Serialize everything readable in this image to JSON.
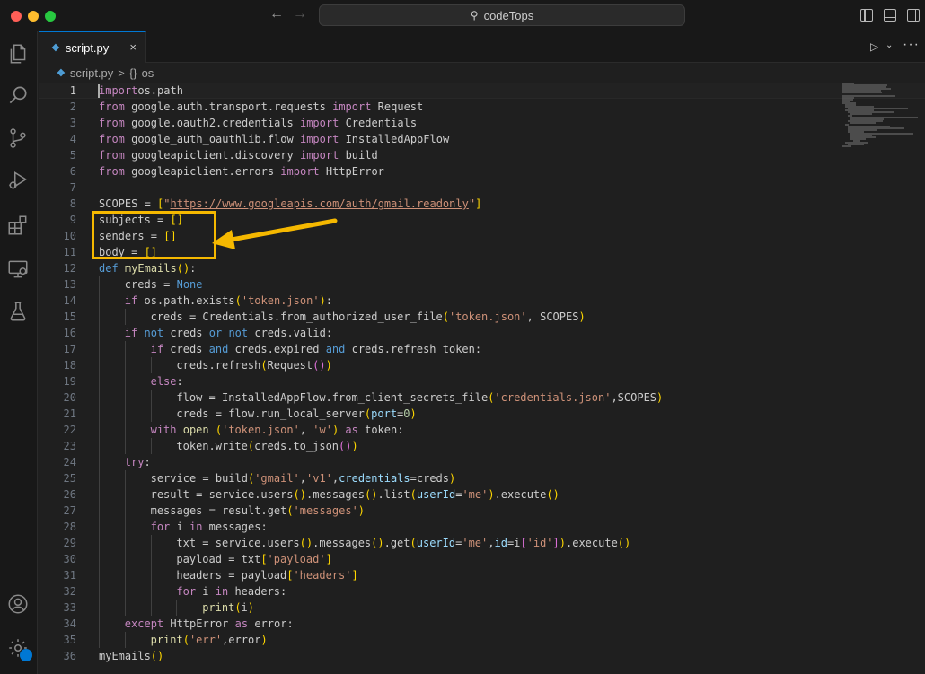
{
  "window": {
    "command_center_text": "codeTops"
  },
  "tab": {
    "label": "script.py",
    "close_glyph": "×"
  },
  "breadcrumb": {
    "file": "script.py",
    "separator": ">",
    "symbol_glyph": "{}",
    "symbol": "os"
  },
  "icons": {
    "activity_bar": [
      "explorer-icon",
      "search-icon",
      "source-control-icon",
      "run-debug-icon",
      "extensions-icon",
      "remote-explorer-icon",
      "testing-icon",
      "account-icon",
      "manage-gear-icon"
    ],
    "title_bar": [
      "back-arrow-icon",
      "forward-arrow-icon",
      "search-icon",
      "toggle-primary-sidebar-icon",
      "toggle-panel-icon",
      "toggle-secondary-sidebar-icon"
    ],
    "editor_actions": [
      "run-python-file-icon",
      "chevron-down-icon",
      "more-actions-icon"
    ]
  },
  "colors": {
    "accent": "#0078d4",
    "annotation": "#f5b800",
    "editor_bg": "#1f1f1f"
  },
  "editor": {
    "current_line": 1,
    "highlighted_lines": [
      9,
      10,
      11
    ],
    "lines": [
      {
        "n": "1",
        "indent": 0,
        "tokens": [
          [
            "kw",
            "import"
          ],
          [
            "",
            "os.path"
          ]
        ]
      },
      {
        "n": "2",
        "indent": 0,
        "tokens": [
          [
            "kw",
            "from"
          ],
          [
            "",
            " google.auth.transport.requests "
          ],
          [
            "kw",
            "import"
          ],
          [
            "",
            " Request"
          ]
        ]
      },
      {
        "n": "3",
        "indent": 0,
        "tokens": [
          [
            "kw",
            "from"
          ],
          [
            "",
            " google.oauth2.credentials "
          ],
          [
            "kw",
            "import"
          ],
          [
            "",
            " Credentials"
          ]
        ]
      },
      {
        "n": "4",
        "indent": 0,
        "tokens": [
          [
            "kw",
            "from"
          ],
          [
            "",
            " google_auth_oauthlib.flow "
          ],
          [
            "kw",
            "import"
          ],
          [
            "",
            " InstalledAppFlow"
          ]
        ]
      },
      {
        "n": "5",
        "indent": 0,
        "tokens": [
          [
            "kw",
            "from"
          ],
          [
            "",
            " googleapiclient.discovery "
          ],
          [
            "kw",
            "import"
          ],
          [
            "",
            " build"
          ]
        ]
      },
      {
        "n": "6",
        "indent": 0,
        "tokens": [
          [
            "kw",
            "from"
          ],
          [
            "",
            " googleapiclient.errors "
          ],
          [
            "kw",
            "import"
          ],
          [
            "",
            " HttpError"
          ]
        ]
      },
      {
        "n": "7",
        "indent": 0,
        "tokens": []
      },
      {
        "n": "8",
        "indent": 0,
        "tokens": [
          [
            "",
            "SCOPES = "
          ],
          [
            "b1",
            "["
          ],
          [
            "str",
            "\""
          ],
          [
            "str url",
            "https://www.googleapis.com/auth/gmail.readonly"
          ],
          [
            "str",
            "\""
          ],
          [
            "b1",
            "]"
          ]
        ]
      },
      {
        "n": "9",
        "indent": 0,
        "tokens": [
          [
            "",
            "subjects = "
          ],
          [
            "b1",
            "[]"
          ]
        ]
      },
      {
        "n": "10",
        "indent": 0,
        "tokens": [
          [
            "",
            "senders = "
          ],
          [
            "b1",
            "[]"
          ]
        ]
      },
      {
        "n": "11",
        "indent": 0,
        "tokens": [
          [
            "",
            "body = "
          ],
          [
            "b1",
            "[]"
          ]
        ]
      },
      {
        "n": "12",
        "indent": 0,
        "tokens": [
          [
            "kwb",
            "def"
          ],
          [
            "",
            " "
          ],
          [
            "fn",
            "myEmails"
          ],
          [
            "b1",
            "()"
          ],
          [
            ":",
            ":"
          ]
        ]
      },
      {
        "n": "13",
        "indent": 1,
        "tokens": [
          [
            "",
            "creds = "
          ],
          [
            "kwb",
            "None"
          ]
        ]
      },
      {
        "n": "14",
        "indent": 1,
        "tokens": [
          [
            "kw",
            "if"
          ],
          [
            "",
            " os.path.exists"
          ],
          [
            "b1",
            "("
          ],
          [
            "str",
            "'token.json'"
          ],
          [
            "b1",
            ")"
          ],
          [
            "",
            ":"
          ]
        ]
      },
      {
        "n": "15",
        "indent": 2,
        "tokens": [
          [
            "",
            "creds = Credentials.from_authorized_user_file"
          ],
          [
            "b1",
            "("
          ],
          [
            "str",
            "'token.json'"
          ],
          [
            "",
            ", SCOPES"
          ],
          [
            "b1",
            ")"
          ]
        ]
      },
      {
        "n": "16",
        "indent": 1,
        "tokens": [
          [
            "kw",
            "if"
          ],
          [
            "",
            " "
          ],
          [
            "kwb",
            "not"
          ],
          [
            "",
            " creds "
          ],
          [
            "kwb",
            "or"
          ],
          [
            "",
            " "
          ],
          [
            "kwb",
            "not"
          ],
          [
            "",
            " creds.valid:"
          ]
        ]
      },
      {
        "n": "17",
        "indent": 2,
        "tokens": [
          [
            "kw",
            "if"
          ],
          [
            "",
            " creds "
          ],
          [
            "kwb",
            "and"
          ],
          [
            "",
            " creds.expired "
          ],
          [
            "kwb",
            "and"
          ],
          [
            "",
            " creds.refresh_token:"
          ]
        ]
      },
      {
        "n": "18",
        "indent": 3,
        "tokens": [
          [
            "",
            "creds.refresh"
          ],
          [
            "b1",
            "("
          ],
          [
            "",
            "Request"
          ],
          [
            "b2",
            "()"
          ],
          [
            "b1",
            ")"
          ]
        ]
      },
      {
        "n": "19",
        "indent": 2,
        "tokens": [
          [
            "kw",
            "else"
          ],
          [
            "",
            ":"
          ]
        ]
      },
      {
        "n": "20",
        "indent": 3,
        "tokens": [
          [
            "",
            "flow = InstalledAppFlow.from_client_secrets_file"
          ],
          [
            "b1",
            "("
          ],
          [
            "str",
            "'credentials.json'"
          ],
          [
            "",
            ",SCOPES"
          ],
          [
            "b1",
            ")"
          ]
        ]
      },
      {
        "n": "21",
        "indent": 3,
        "tokens": [
          [
            "",
            "creds = flow.run_local_server"
          ],
          [
            "b1",
            "("
          ],
          [
            "param",
            "port"
          ],
          [
            "",
            "="
          ],
          [
            "num",
            "0"
          ],
          [
            "b1",
            ")"
          ]
        ]
      },
      {
        "n": "22",
        "indent": 2,
        "tokens": [
          [
            "kw",
            "with"
          ],
          [
            "",
            " "
          ],
          [
            "fn",
            "open"
          ],
          [
            "",
            " "
          ],
          [
            "b1",
            "("
          ],
          [
            "str",
            "'token.json'"
          ],
          [
            "",
            ", "
          ],
          [
            "str",
            "'w'"
          ],
          [
            "b1",
            ")"
          ],
          [
            "",
            " "
          ],
          [
            "kw",
            "as"
          ],
          [
            "",
            " token:"
          ]
        ]
      },
      {
        "n": "23",
        "indent": 3,
        "tokens": [
          [
            "",
            "token.write"
          ],
          [
            "b1",
            "("
          ],
          [
            "",
            "creds.to_json"
          ],
          [
            "b2",
            "()"
          ],
          [
            "b1",
            ")"
          ]
        ]
      },
      {
        "n": "24",
        "indent": 1,
        "tokens": [
          [
            "kw",
            "try"
          ],
          [
            "",
            ":"
          ]
        ]
      },
      {
        "n": "25",
        "indent": 2,
        "tokens": [
          [
            "",
            "service = build"
          ],
          [
            "b1",
            "("
          ],
          [
            "str",
            "'gmail'"
          ],
          [
            "",
            ","
          ],
          [
            "str",
            "'v1'"
          ],
          [
            "",
            ","
          ],
          [
            "param",
            "credentials"
          ],
          [
            "",
            "=creds"
          ],
          [
            "b1",
            ")"
          ]
        ]
      },
      {
        "n": "26",
        "indent": 2,
        "tokens": [
          [
            "",
            "result = service.users"
          ],
          [
            "b1",
            "()"
          ],
          [
            "",
            ".messages"
          ],
          [
            "b1",
            "()"
          ],
          [
            "",
            ".list"
          ],
          [
            "b1",
            "("
          ],
          [
            "param",
            "userId"
          ],
          [
            "",
            "="
          ],
          [
            "str",
            "'me'"
          ],
          [
            "b1",
            ")"
          ],
          [
            "",
            ".execute"
          ],
          [
            "b1",
            "()"
          ]
        ]
      },
      {
        "n": "27",
        "indent": 2,
        "tokens": [
          [
            "",
            "messages = result.get"
          ],
          [
            "b1",
            "("
          ],
          [
            "str",
            "'messages'"
          ],
          [
            "b1",
            ")"
          ]
        ]
      },
      {
        "n": "28",
        "indent": 2,
        "tokens": [
          [
            "kw",
            "for"
          ],
          [
            "",
            " i "
          ],
          [
            "kw",
            "in"
          ],
          [
            "",
            " messages:"
          ]
        ]
      },
      {
        "n": "29",
        "indent": 3,
        "tokens": [
          [
            "",
            "txt = service.users"
          ],
          [
            "b1",
            "()"
          ],
          [
            "",
            ".messages"
          ],
          [
            "b1",
            "()"
          ],
          [
            "",
            ".get"
          ],
          [
            "b1",
            "("
          ],
          [
            "param",
            "userId"
          ],
          [
            "",
            "="
          ],
          [
            "str",
            "'me'"
          ],
          [
            "",
            ","
          ],
          [
            "param",
            "id"
          ],
          [
            "",
            "=i"
          ],
          [
            "b2",
            "["
          ],
          [
            "str",
            "'id'"
          ],
          [
            "b2",
            "]"
          ],
          [
            "b1",
            ")"
          ],
          [
            "",
            ".execute"
          ],
          [
            "b1",
            "()"
          ]
        ]
      },
      {
        "n": "30",
        "indent": 3,
        "tokens": [
          [
            "",
            "payload = txt"
          ],
          [
            "b1",
            "["
          ],
          [
            "str",
            "'payload'"
          ],
          [
            "b1",
            "]"
          ]
        ]
      },
      {
        "n": "31",
        "indent": 3,
        "tokens": [
          [
            "",
            "headers = payload"
          ],
          [
            "b1",
            "["
          ],
          [
            "str",
            "'headers'"
          ],
          [
            "b1",
            "]"
          ]
        ]
      },
      {
        "n": "32",
        "indent": 3,
        "tokens": [
          [
            "kw",
            "for"
          ],
          [
            "",
            " i "
          ],
          [
            "kw",
            "in"
          ],
          [
            "",
            " headers:"
          ]
        ]
      },
      {
        "n": "33",
        "indent": 4,
        "tokens": [
          [
            "fn",
            "print"
          ],
          [
            "b1",
            "("
          ],
          [
            "",
            "i"
          ],
          [
            "b1",
            ")"
          ]
        ]
      },
      {
        "n": "34",
        "indent": 1,
        "tokens": [
          [
            "kw",
            "except"
          ],
          [
            "",
            " HttpError "
          ],
          [
            "kw",
            "as"
          ],
          [
            "",
            " error:"
          ]
        ]
      },
      {
        "n": "35",
        "indent": 2,
        "tokens": [
          [
            "fn",
            "print"
          ],
          [
            "b1",
            "("
          ],
          [
            "str",
            "'err'"
          ],
          [
            "",
            ",error"
          ],
          [
            "b1",
            ")"
          ]
        ]
      },
      {
        "n": "36",
        "indent": 0,
        "tokens": [
          [
            "",
            "myEmails"
          ],
          [
            "b1",
            "()"
          ]
        ]
      }
    ]
  }
}
